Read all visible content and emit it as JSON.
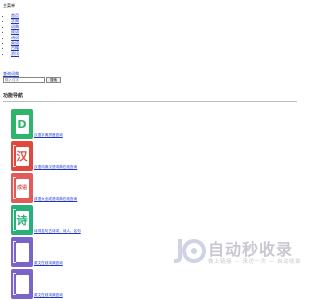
{
  "header": {
    "main_menu": "主菜单"
  },
  "nav": {
    "items": [
      {
        "label": "首页"
      },
      {
        "label": "字典"
      },
      {
        "label": "词典"
      },
      {
        "label": "成语"
      },
      {
        "label": "诗词"
      },
      {
        "label": "英语"
      },
      {
        "label": "古籍"
      },
      {
        "label": "资讯"
      }
    ]
  },
  "search": {
    "label": "查询词典",
    "placeholder": "输入汉字",
    "button": "搜索"
  },
  "section": {
    "title": "功能导航"
  },
  "tools": [
    {
      "label": "汉语字典拼音查询",
      "icon_text": "D",
      "color": "#2fb56b",
      "text_color": "#2fb56b",
      "icon": "dictionary-d-icon"
    },
    {
      "label": "汉语词典汉语词典在线查询",
      "icon_text": "汉",
      "color": "#e0483c",
      "text_color": "#e0483c",
      "icon": "hanzi-book-icon"
    },
    {
      "label": "成语大全成语词典在线查询",
      "icon_text": "成语",
      "color": "#e25a5a",
      "text_color": "#e25a5a",
      "icon": "idiom-book-icon"
    },
    {
      "label": "诗词名句古诗词，诗人，名句",
      "icon_text": "诗",
      "color": "#28b07a",
      "text_color": "#28b07a",
      "icon": "poetry-book-icon"
    },
    {
      "label": "英文在线词典查询",
      "icon_text": "",
      "color": "#7a63c9",
      "text_color": "#7a63c9",
      "icon": "english-book-icon"
    },
    {
      "label": "英文在线词典查询",
      "icon_text": "",
      "color": "#7a63c9",
      "text_color": "#7a63c9",
      "icon": "english-book-icon-2"
    }
  ],
  "watermark": {
    "text": "自动秒收录",
    "subtitle": "做上链接 — 来访一次 — 自动收录"
  }
}
